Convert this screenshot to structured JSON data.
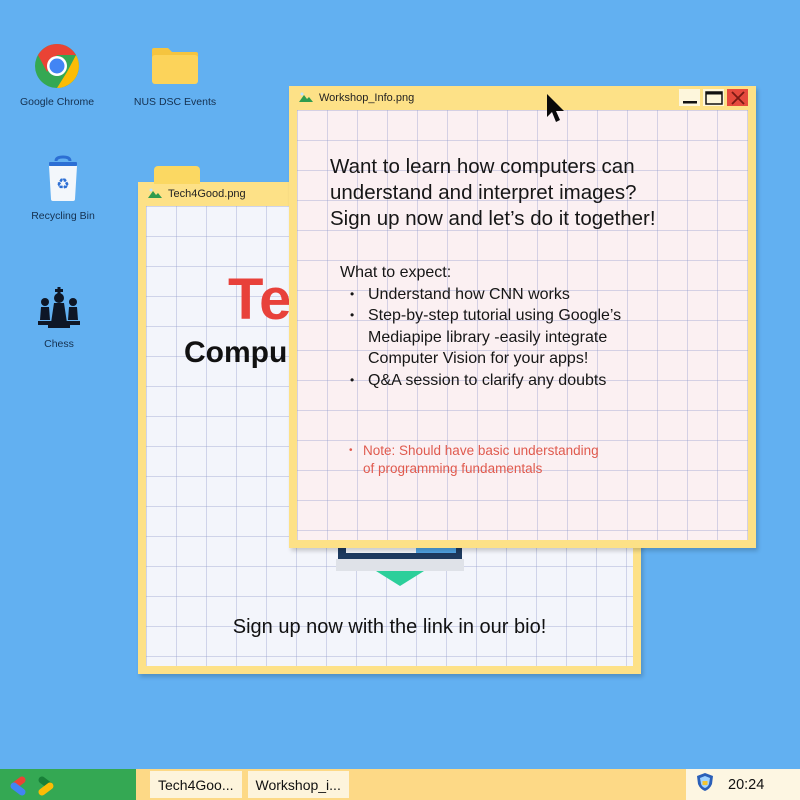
{
  "desktop": {
    "icons": [
      {
        "label": "Google Chrome",
        "icon": "chrome-icon"
      },
      {
        "label": "NUS DSC Events",
        "icon": "folder-icon"
      },
      {
        "label": "Recycling Bin",
        "icon": "recycle-bin-icon"
      },
      {
        "label": "Chess",
        "icon": "chess-icon"
      }
    ]
  },
  "windows": {
    "tech4good": {
      "title": "Tech4Good.png",
      "big_text": "Te",
      "sub_text": "Compu",
      "footer": "Sign up now with the link in our bio!"
    },
    "workshop": {
      "title": "Workshop_Info.png",
      "headline": [
        "Want to learn how computers can",
        "understand and interpret images?",
        "Sign up now and let’s do it together!"
      ],
      "expect_title": "What to expect:",
      "bullets": [
        "Understand how CNN works",
        "Step-by-step tutorial using Google’s Mediapipe library -easily integrate Computer Vision for your apps!",
        "Q&A session to clarify any doubts"
      ],
      "note": [
        "Note: Should have basic understanding",
        "of programming fundamentals"
      ],
      "controls": {
        "minimize": "minimize",
        "maximize": "maximize",
        "close": "close"
      }
    }
  },
  "taskbar": {
    "tasks": [
      "Tech4Goo...",
      "Workshop_i..."
    ],
    "clock": "20:24",
    "colors": {
      "start": "#34a853",
      "bar": "#fdd986"
    }
  }
}
